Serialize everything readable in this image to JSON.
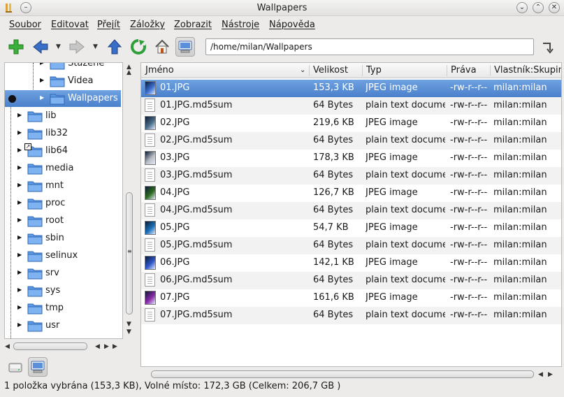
{
  "window": {
    "title": "Wallpapers"
  },
  "menu": [
    {
      "label": "Soubor"
    },
    {
      "label": "Editovat"
    },
    {
      "label": "Přejít"
    },
    {
      "label": "Záložky"
    },
    {
      "label": "Zobrazit"
    },
    {
      "label": "Nástroje"
    },
    {
      "label": "Nápověda"
    }
  ],
  "toolbar": {
    "address": "/home/milan/Wallpapers",
    "colors": {
      "add": "#3bb13b",
      "back": "#3a6fc8",
      "reload": "#2f9f3a"
    }
  },
  "tree": {
    "items": [
      {
        "label": "Stažené",
        "level": 2
      },
      {
        "label": "Videa",
        "level": 2
      },
      {
        "label": "Wallpapers",
        "level": 2,
        "selected": true
      },
      {
        "label": "lib",
        "level": 1
      },
      {
        "label": "lib32",
        "level": 1
      },
      {
        "label": "lib64",
        "level": 1,
        "symlink": true
      },
      {
        "label": "media",
        "level": 1
      },
      {
        "label": "mnt",
        "level": 1
      },
      {
        "label": "proc",
        "level": 1
      },
      {
        "label": "root",
        "level": 1
      },
      {
        "label": "sbin",
        "level": 1
      },
      {
        "label": "selinux",
        "level": 1
      },
      {
        "label": "srv",
        "level": 1
      },
      {
        "label": "sys",
        "level": 1
      },
      {
        "label": "tmp",
        "level": 1
      },
      {
        "label": "usr",
        "level": 1
      }
    ]
  },
  "files": {
    "columns": [
      "Jméno",
      "Velikost",
      "Typ",
      "Práva",
      "Vlastník:Skupin"
    ],
    "rows": [
      {
        "name": "01.JPG",
        "size": "153,3 KB",
        "type": "JPEG image",
        "perms": "-rw-r--r--",
        "owner": "milan:milan",
        "kind": "image",
        "color": "#3a6fd0",
        "selected": true
      },
      {
        "name": "01.JPG.md5sum",
        "size": "64 Bytes",
        "type": "plain text docume",
        "perms": "-rw-r--r--",
        "owner": "milan:milan",
        "kind": "text"
      },
      {
        "name": "02.JPG",
        "size": "219,6 KB",
        "type": "JPEG image",
        "perms": "-rw-r--r--",
        "owner": "milan:milan",
        "kind": "image",
        "color": "#4a6d8a"
      },
      {
        "name": "02.JPG.md5sum",
        "size": "64 Bytes",
        "type": "plain text docume",
        "perms": "-rw-r--r--",
        "owner": "milan:milan",
        "kind": "text"
      },
      {
        "name": "03.JPG",
        "size": "178,3 KB",
        "type": "JPEG image",
        "perms": "-rw-r--r--",
        "owner": "milan:milan",
        "kind": "image",
        "color": "#b8bcc4"
      },
      {
        "name": "03.JPG.md5sum",
        "size": "64 Bytes",
        "type": "plain text docume",
        "perms": "-rw-r--r--",
        "owner": "milan:milan",
        "kind": "text"
      },
      {
        "name": "04.JPG",
        "size": "126,7 KB",
        "type": "JPEG image",
        "perms": "-rw-r--r--",
        "owner": "milan:milan",
        "kind": "image",
        "color": "#2e6a1e"
      },
      {
        "name": "04.JPG.md5sum",
        "size": "64 Bytes",
        "type": "plain text docume",
        "perms": "-rw-r--r--",
        "owner": "milan:milan",
        "kind": "text"
      },
      {
        "name": "05.JPG",
        "size": "54,7 KB",
        "type": "JPEG image",
        "perms": "-rw-r--r--",
        "owner": "milan:milan",
        "kind": "image",
        "color": "#1a6fb8"
      },
      {
        "name": "05.JPG.md5sum",
        "size": "64 Bytes",
        "type": "plain text docume",
        "perms": "-rw-r--r--",
        "owner": "milan:milan",
        "kind": "text"
      },
      {
        "name": "06.JPG",
        "size": "142,1 KB",
        "type": "JPEG image",
        "perms": "-rw-r--r--",
        "owner": "milan:milan",
        "kind": "image",
        "color": "#2c55c8"
      },
      {
        "name": "06.JPG.md5sum",
        "size": "64 Bytes",
        "type": "plain text docume",
        "perms": "-rw-r--r--",
        "owner": "milan:milan",
        "kind": "text"
      },
      {
        "name": "07.JPG",
        "size": "161,6 KB",
        "type": "JPEG image",
        "perms": "-rw-r--r--",
        "owner": "milan:milan",
        "kind": "image",
        "color": "#8a2aa8"
      },
      {
        "name": "07.JPG.md5sum",
        "size": "64 Bytes",
        "type": "plain text docume",
        "perms": "-rw-r--r--",
        "owner": "milan:milan",
        "kind": "text"
      }
    ]
  },
  "status": {
    "text": "1 položka vybrána (153,3 KB), Volné místo: 172,3 GB (Celkem: 206,7 GB )"
  },
  "colors": {
    "selection": "#4b80cc",
    "folder": "#5c9ae6"
  }
}
